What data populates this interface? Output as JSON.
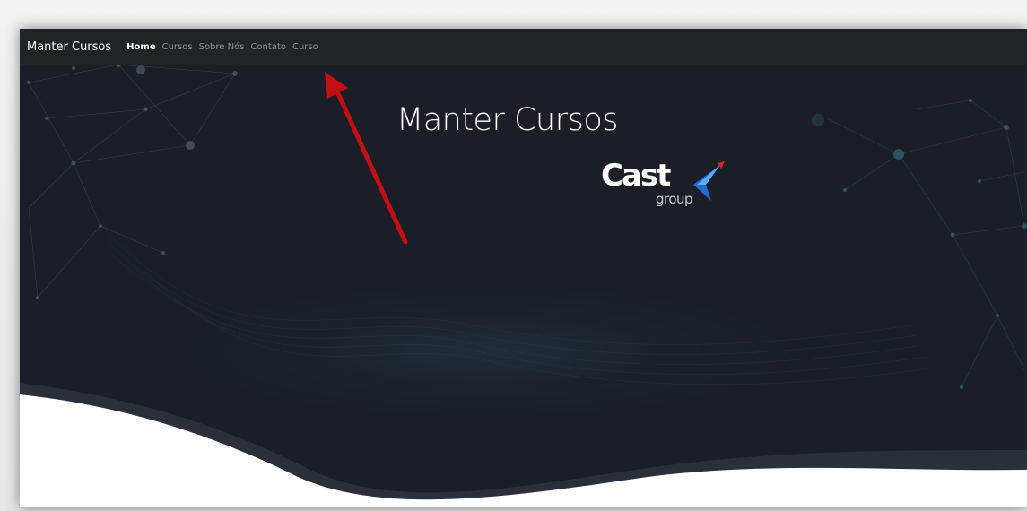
{
  "navbar": {
    "brand": "Manter Cursos",
    "links": [
      {
        "label": "Home",
        "active": true
      },
      {
        "label": "Cursos",
        "active": false
      },
      {
        "label": "Sobre Nós",
        "active": false
      },
      {
        "label": "Contato",
        "active": false
      },
      {
        "label": "Curso",
        "active": false
      }
    ]
  },
  "hero": {
    "title": "Manter Cursos",
    "logo": {
      "word": "Cast",
      "sub": "group"
    }
  },
  "colors": {
    "background": "#1b1e26",
    "navbar": "#212327",
    "wave": "#ffffff",
    "arrow": "#c20f12",
    "logo_blue": "#1f6fd1",
    "logo_red": "#d8262a"
  },
  "annotation": {
    "icon": "red-arrow-icon",
    "points_to": "Curso"
  }
}
